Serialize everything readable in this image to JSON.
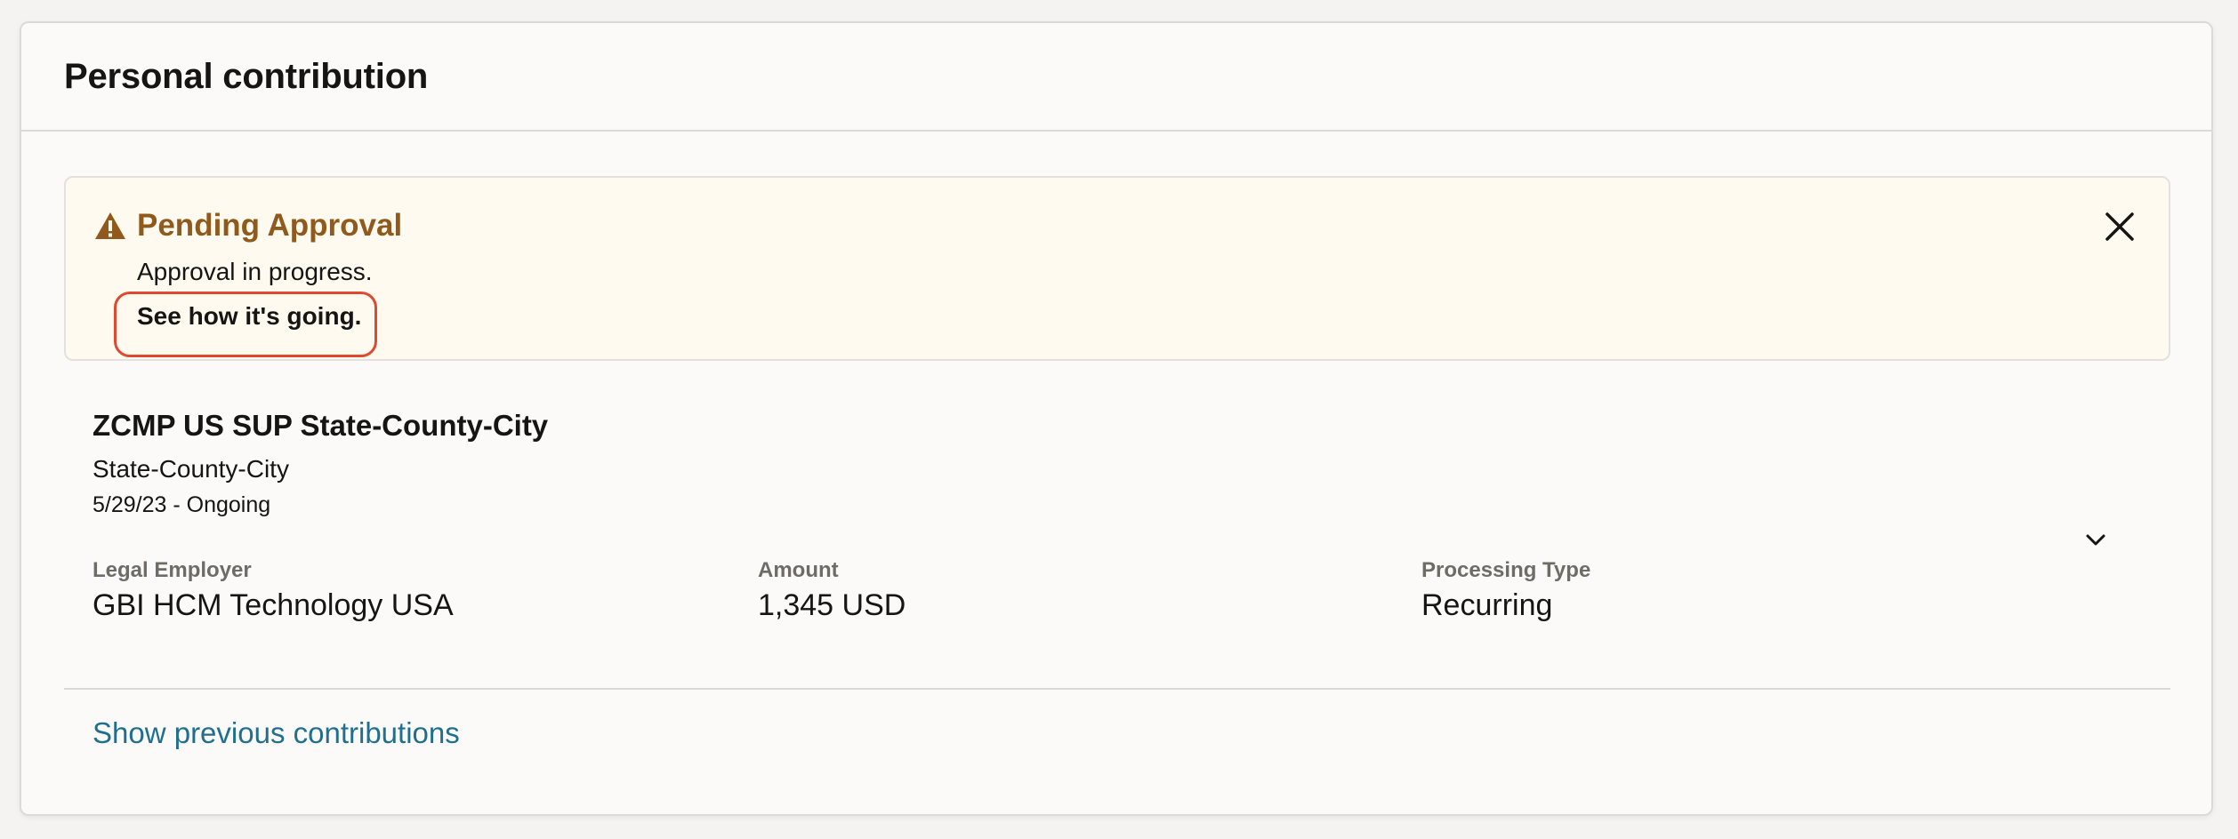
{
  "card": {
    "title": "Personal contribution"
  },
  "alert": {
    "icon": "warning-triangle-icon",
    "title": "Pending Approval",
    "message": "Approval in progress.",
    "link_label": "See how it's going.",
    "close_icon": "close-icon",
    "colors": {
      "title": "#8f5a1c",
      "background": "#fefaf0",
      "highlight": "#e0492f"
    }
  },
  "contribution": {
    "name": "ZCMP US SUP State-County-City",
    "subtitle": "State-County-City",
    "dates": "5/29/23 - Ongoing",
    "expand_icon": "chevron-down-icon",
    "fields": [
      {
        "label": "Legal Employer",
        "value": "GBI HCM Technology USA"
      },
      {
        "label": "Amount",
        "value": "1,345 USD"
      },
      {
        "label": "Processing Type",
        "value": "Recurring"
      }
    ]
  },
  "footer": {
    "show_previous_label": "Show previous contributions",
    "link_color": "#216f8e"
  }
}
